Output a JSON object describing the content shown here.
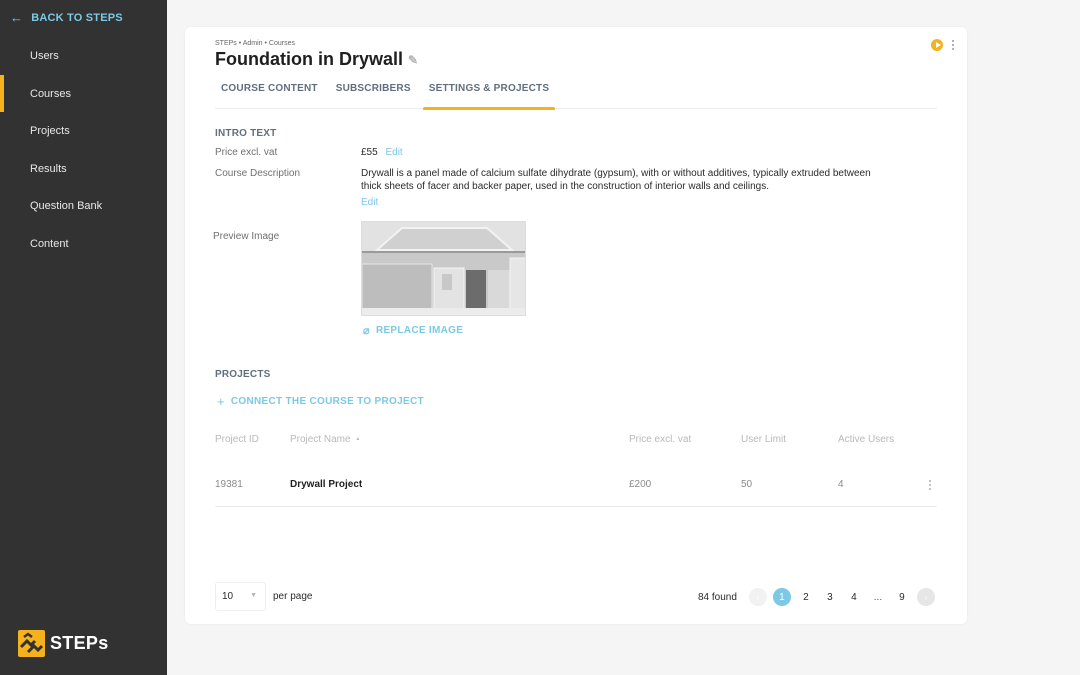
{
  "sidebar": {
    "back_label": "BACK TO STEPS",
    "back_icon": "arrow-left-icon",
    "items": [
      {
        "label": "Users",
        "active": false
      },
      {
        "label": "Courses",
        "active": true
      },
      {
        "label": "Projects",
        "active": false
      },
      {
        "label": "Results",
        "active": false
      },
      {
        "label": "Question Bank",
        "active": false
      },
      {
        "label": "Content",
        "active": false
      }
    ],
    "logo_text": "STEPs"
  },
  "header": {
    "breadcrumb": "STEPs • Admin • Courses",
    "title": "Foundation in Drywall",
    "edit_icon": "pencil-icon",
    "play_icon": "play-icon",
    "more_icon": "kebab-icon"
  },
  "tabs": [
    {
      "label": "COURSE CONTENT",
      "active": false
    },
    {
      "label": "SUBSCRIBERS",
      "active": false
    },
    {
      "label": "SETTINGS & PROJECTS",
      "active": true
    }
  ],
  "intro": {
    "section_title": "INTRO TEXT",
    "price_label": "Price excl. vat",
    "price_value": "£55",
    "price_edit": "Edit",
    "description_label": "Course Description",
    "description_line1": "Drywall is a panel made of calcium sulfate dihydrate (gypsum), with or without additives, typically extruded between",
    "description_line2": "thick sheets of facer and backer paper, used in the construction of interior walls and ceilings.",
    "description_edit": "Edit",
    "preview_label": "Preview Image",
    "replace_label": "REPLACE IMAGE",
    "replace_icon": "paperclip-icon"
  },
  "projects": {
    "section_title": "PROJECTS",
    "connect_label": "CONNECT THE COURSE TO PROJECT",
    "connect_icon": "plus-icon",
    "columns": [
      "Project ID",
      "Project Name",
      "Price excl. vat",
      "User Limit",
      "Active Users"
    ],
    "sort_indicator": "▲",
    "rows": [
      {
        "id": "19381",
        "name": "Drywall Project",
        "price": "£200",
        "user_limit": "50",
        "active_users": "4"
      }
    ]
  },
  "footer": {
    "per_page_value": "10",
    "per_page_label": "per page",
    "found_text": "84 found",
    "pages": [
      "1",
      "2",
      "3",
      "4",
      "...",
      "9"
    ],
    "current_page": "1",
    "prev_icon": "chevron-left-icon",
    "next_icon": "chevron-right-icon"
  },
  "colors": {
    "accent": "#f6b21d",
    "link": "#7cc9e6",
    "sidebar_bg": "#323232"
  }
}
